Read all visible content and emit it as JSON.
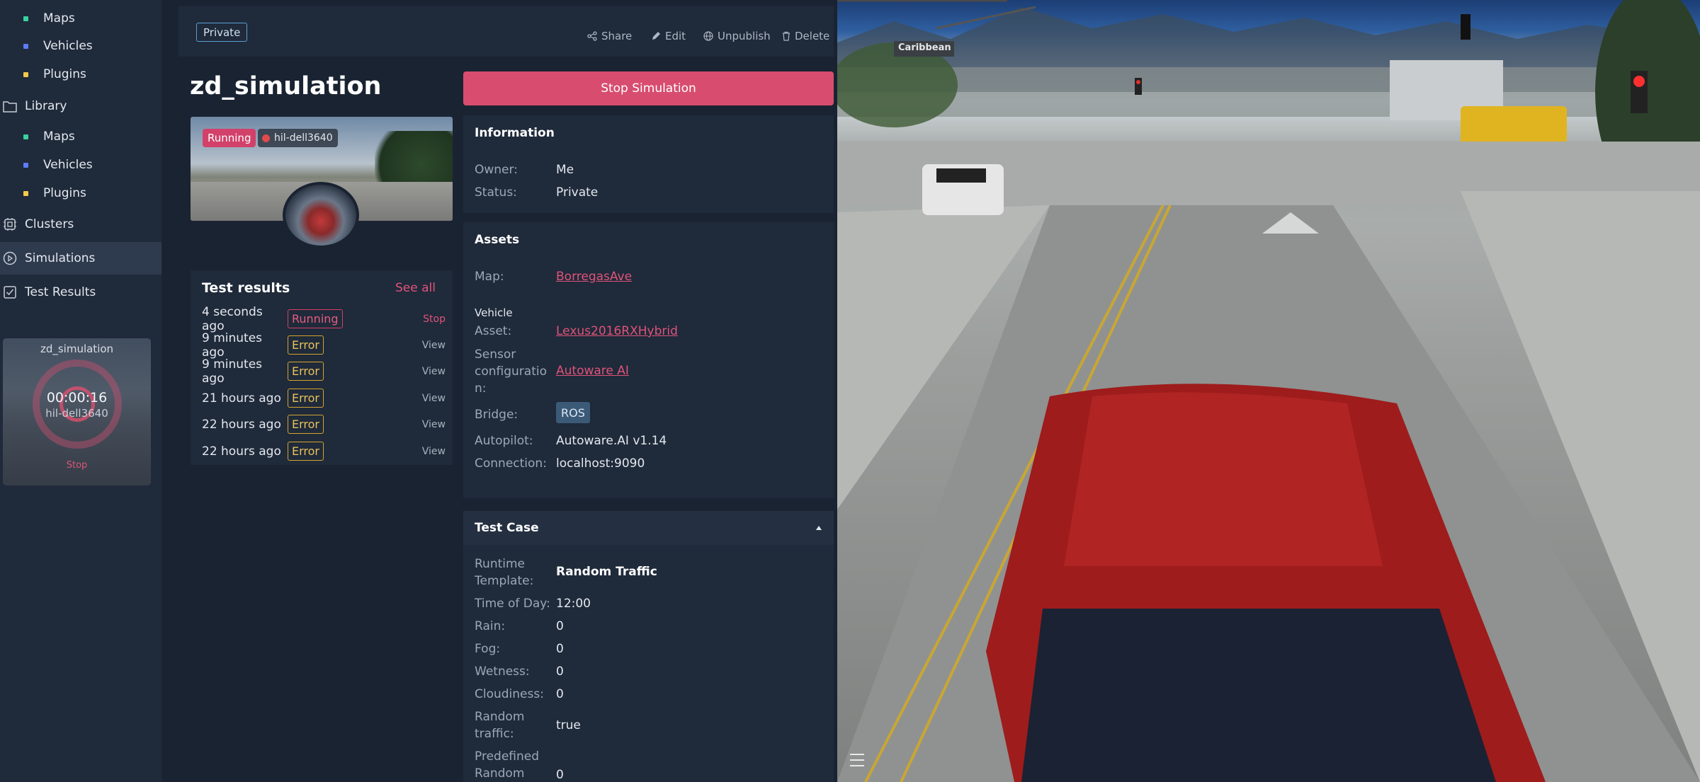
{
  "sidebar": {
    "items": [
      {
        "label": "Maps",
        "dot": "#3ad29f"
      },
      {
        "label": "Vehicles",
        "dot": "#5c7cfa"
      },
      {
        "label": "Plugins",
        "dot": "#f2c94c"
      }
    ],
    "library": {
      "label": "Library",
      "icon": "folder-icon"
    },
    "library_items": [
      {
        "label": "Maps",
        "dot": "#3ad29f"
      },
      {
        "label": "Vehicles",
        "dot": "#5c7cfa"
      },
      {
        "label": "Plugins",
        "dot": "#f2c94c"
      }
    ],
    "clusters": {
      "label": "Clusters",
      "icon": "cluster-icon"
    },
    "simulations": {
      "label": "Simulations",
      "icon": "play-circle-icon"
    },
    "test_results": {
      "label": "Test Results",
      "icon": "checklist-icon"
    },
    "mini": {
      "title": "zd_simulation",
      "timer": "00:00:16",
      "host": "hil-dell3640",
      "stop": "Stop"
    }
  },
  "header": {
    "visibility": "Private",
    "actions": {
      "share": "Share",
      "edit": "Edit",
      "unpublish": "Unpublish",
      "delete": "Delete"
    }
  },
  "simulation": {
    "title": "zd_simulation",
    "status_badge": "Running",
    "host": "hil-dell3640",
    "stop_button": "Stop Simulation"
  },
  "test_results": {
    "title": "Test results",
    "see_all": "See all",
    "rows": [
      {
        "ago": "4 seconds ago",
        "status": "Running",
        "action": "Stop"
      },
      {
        "ago": "9 minutes ago",
        "status": "Error",
        "action": "View"
      },
      {
        "ago": "9 minutes ago",
        "status": "Error",
        "action": "View"
      },
      {
        "ago": "21 hours ago",
        "status": "Error",
        "action": "View"
      },
      {
        "ago": "22 hours ago",
        "status": "Error",
        "action": "View"
      },
      {
        "ago": "22 hours ago",
        "status": "Error",
        "action": "View"
      }
    ]
  },
  "information": {
    "title": "Information",
    "owner_label": "Owner:",
    "owner": "Me",
    "status_label": "Status:",
    "status": "Private"
  },
  "assets": {
    "title": "Assets",
    "map_label": "Map:",
    "map": "BorregasAve",
    "vehicle_heading": "Vehicle",
    "asset_label": "Asset:",
    "asset": "Lexus2016RXHybrid",
    "sensor_label_1": "Sensor",
    "sensor_label_2": "configuratio",
    "sensor_label_3": "n:",
    "sensor": "Autoware AI",
    "bridge_label": "Bridge:",
    "bridge": "ROS",
    "autopilot_label": "Autopilot:",
    "autopilot": "Autoware.AI v1.14",
    "connection_label": "Connection:",
    "connection": "localhost:9090"
  },
  "test_case": {
    "title": "Test Case",
    "runtime_label_1": "Runtime",
    "runtime_label_2": "Template:",
    "runtime": "Random Traffic",
    "time_label": "Time of Day:",
    "time": "12:00",
    "rain_label": "Rain:",
    "rain": "0",
    "fog_label": "Fog:",
    "fog": "0",
    "wetness_label": "Wetness:",
    "wetness": "0",
    "cloudiness_label": "Cloudiness:",
    "cloudiness": "0",
    "random_traffic_label_1": "Random",
    "random_traffic_label_2": "traffic:",
    "random_traffic": "true",
    "predefined_label_1": "Predefined",
    "predefined_label_2": "Random",
    "predefined": "0"
  },
  "viewport": {
    "street_sign": "Caribbean"
  },
  "colors": {
    "accent": "#d84d6f",
    "error": "#d6a530",
    "link": "#e0537a",
    "panel": "#1f2a3a",
    "background": "#1a2332"
  }
}
